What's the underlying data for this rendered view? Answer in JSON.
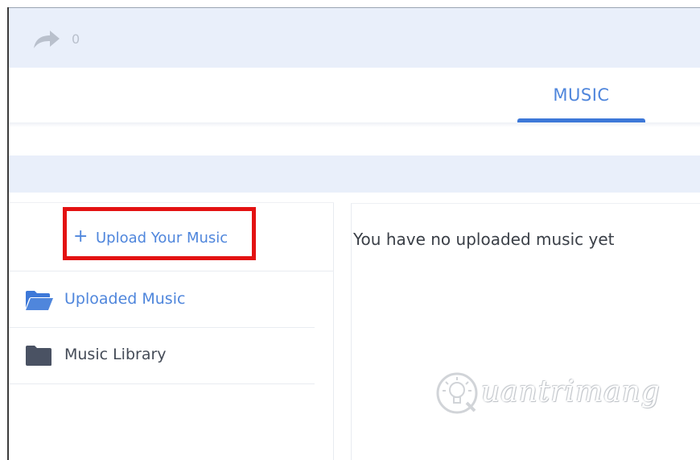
{
  "share": {
    "icon": "share-arrow-icon",
    "count": "0"
  },
  "tabs": [
    {
      "label": "MUSIC",
      "active": true
    }
  ],
  "sidebar": {
    "upload": {
      "icon": "plus-icon",
      "plus": "+",
      "label": "Upload Your Music"
    },
    "items": [
      {
        "label": "Uploaded Music",
        "icon": "folder-open-icon",
        "active": true
      },
      {
        "label": "Music Library",
        "icon": "folder-icon",
        "active": false
      }
    ]
  },
  "main": {
    "empty_message": "You have no uploaded music yet"
  },
  "watermark": {
    "text": "uantrimang"
  },
  "colors": {
    "accent": "#4f86dc",
    "tab_underline": "#3d78d8",
    "highlight_box": "#e31212",
    "band": "#e9effa",
    "folder_dark": "#4a5263"
  }
}
